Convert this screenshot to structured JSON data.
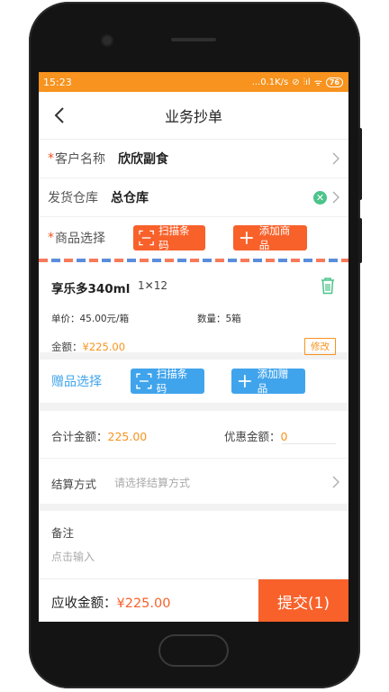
{
  "status_bar": {
    "time": "15:23",
    "net_speed": "...0.1K/s",
    "battery": "76"
  },
  "nav": {
    "title": "业务抄单"
  },
  "form": {
    "customer": {
      "required_mark": "*",
      "label": "客户名称",
      "value": "欣欣副食"
    },
    "warehouse": {
      "label": "发货仓库",
      "value": "总仓库"
    },
    "goods_select": {
      "required_mark": "*",
      "label": "商品选择",
      "scan_label": "扫描条码",
      "add_label": "添加商品"
    }
  },
  "product": {
    "name": "享乐多340ml",
    "spec": "1✕12",
    "unit_price": "单价：45.00元/箱",
    "quantity": "数量：5箱",
    "amount_label": "金额：",
    "amount_value": "¥225.00",
    "edit_label": "修改"
  },
  "gifts": {
    "label": "赠品选择",
    "scan_label": "扫描条码",
    "add_label": "添加赠品"
  },
  "totals": {
    "total_label": "合计金额：",
    "total_value": "225.00",
    "discount_label": "优惠金额：",
    "discount_value": "0"
  },
  "settlement": {
    "label": "结算方式",
    "placeholder": "请选择结算方式"
  },
  "remark": {
    "label": "备注",
    "placeholder": "点击输入"
  },
  "footer": {
    "due_label": "应收金额：",
    "due_value": "¥225.00",
    "submit_label": "提交(1)"
  },
  "colors": {
    "orange": "#f7931e",
    "accent_red": "#f8612a",
    "blue": "#40a4ec",
    "green": "#4cc38a"
  }
}
